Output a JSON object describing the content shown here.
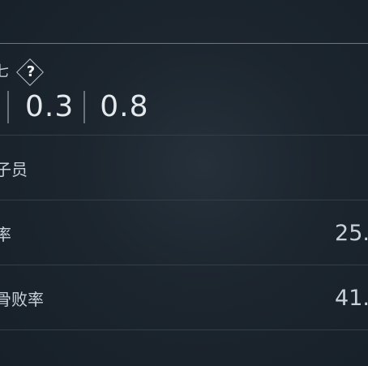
{
  "kda": {
    "label": "七",
    "help_icon": "question-diamond-icon",
    "help_glyph": "?",
    "values": [
      "0.3",
      "0.8"
    ]
  },
  "rows": [
    {
      "label": "子员",
      "value": ""
    },
    {
      "label": "率",
      "value": "25."
    },
    {
      "label": "骨败率",
      "value": "41."
    }
  ]
}
